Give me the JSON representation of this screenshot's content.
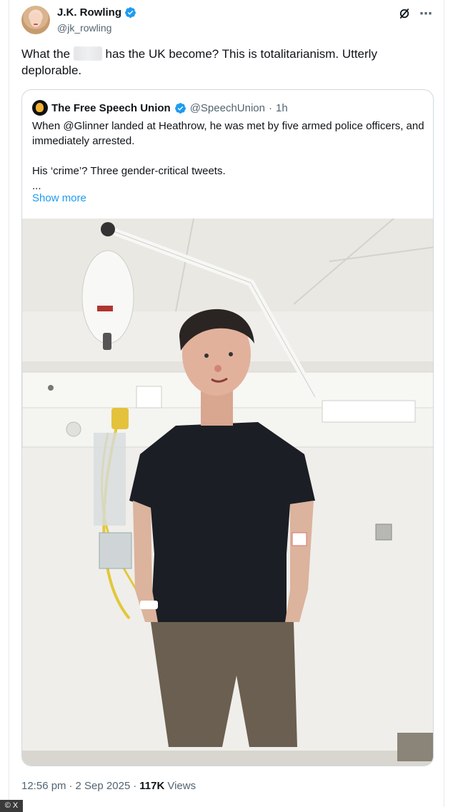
{
  "author": {
    "name": "J.K. Rowling",
    "handle": "@jk_rowling",
    "verified_color": "#1d9bf0"
  },
  "tweet": {
    "text_before": "What the ",
    "text_after": " has the UK become? This is totalitarianism. Utterly deplorable."
  },
  "quote": {
    "name": "The Free Speech Union",
    "handle": "@SpeechUnion",
    "separator": "·",
    "time": "1h",
    "line1": "When @Glinner landed at Heathrow, he was met by five armed police officers, and immediately arrested.",
    "line2": "His ‘crime’? Three gender-critical tweets.",
    "line3": "...",
    "show_more": "Show more"
  },
  "meta": {
    "time": "12:56 pm",
    "separator": "·",
    "date": "2 Sep 2025",
    "separator2": "·",
    "views_count": "117K",
    "views_label": "Views"
  },
  "credit": "© X",
  "colors": {
    "link": "#1d9bf0",
    "secondary_text": "#536471",
    "border": "#cfd9de"
  },
  "icons": [
    "verified-badge-icon",
    "grok-icon",
    "more-icon"
  ]
}
